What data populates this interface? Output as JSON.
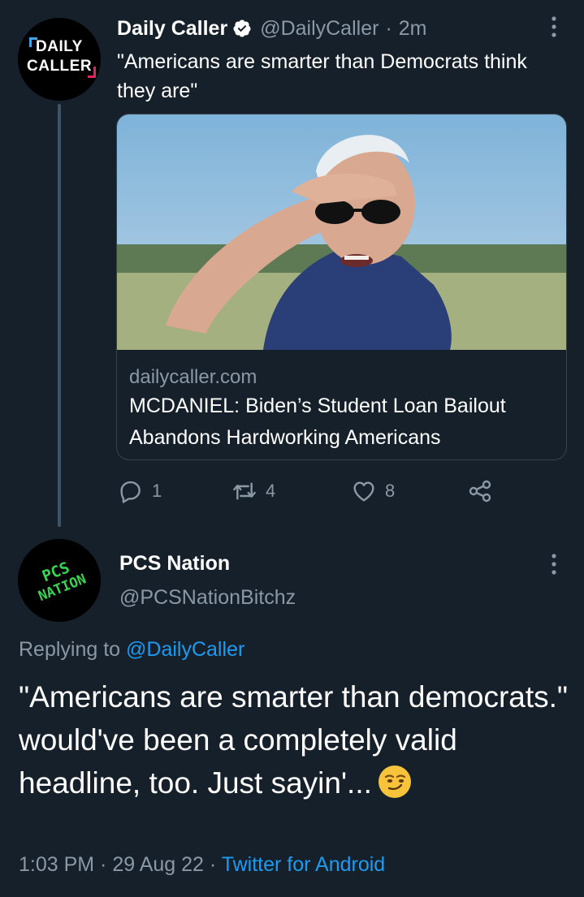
{
  "parent_tweet": {
    "display_name": "Daily Caller",
    "handle": "@DailyCaller",
    "separator": "·",
    "time_ago": "2m",
    "text": "\"Americans are smarter than Democrats think they are\"",
    "avatar_logo": {
      "line1": "DAILY",
      "line2": "CALLER"
    },
    "link_card": {
      "domain": "dailycaller.com",
      "title": "MCDANIEL: Biden’s Student Loan Bailout Abandons Hardworking Americans"
    },
    "actions": {
      "replies": "1",
      "retweets": "4",
      "likes": "8"
    }
  },
  "reply_tweet": {
    "display_name": "PCS Nation",
    "handle": "@PCSNationBitchz",
    "avatar_logo": {
      "line1": "PCS",
      "line2": "NATION"
    },
    "replying_prefix": "Replying to",
    "replying_to": "@DailyCaller",
    "text": "\"Americans are smarter than democrats.\" would've been a completely valid headline, too. Just sayin'...",
    "time": "1:03 PM",
    "date": "29 Aug 22",
    "meta_separator": " · ",
    "source": "Twitter for Android"
  },
  "colors": {
    "background": "#15202b",
    "secondary_text": "#8b98a5",
    "link_blue": "#1d9bf0",
    "divider": "#38444d",
    "avatar_green": "#39d353"
  }
}
